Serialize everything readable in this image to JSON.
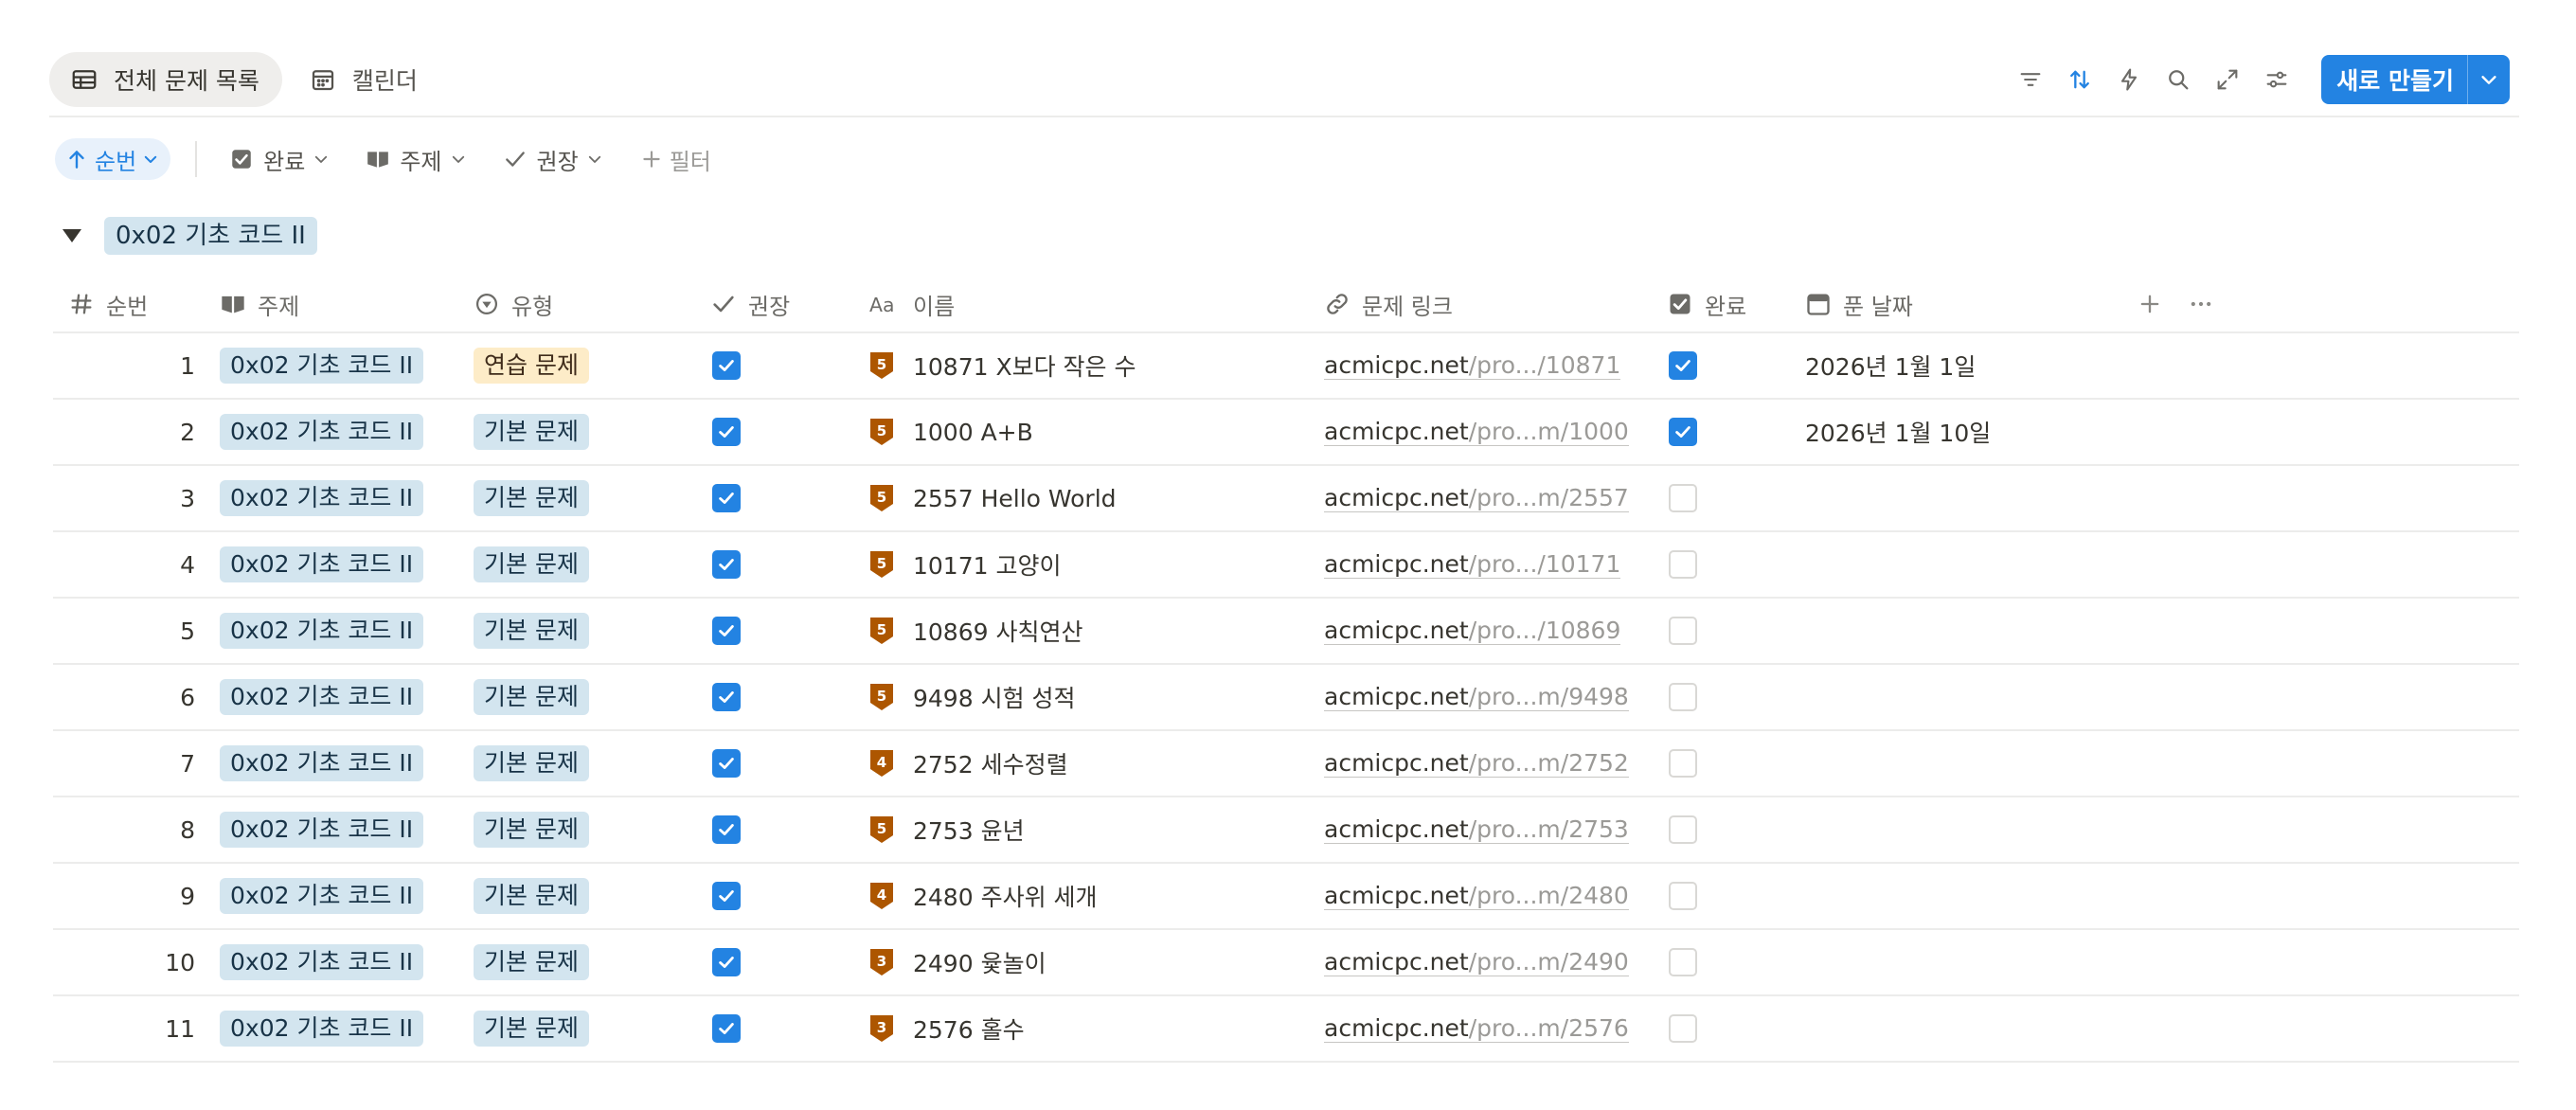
{
  "views": [
    {
      "label": "전체 문제 목록",
      "icon": "table-icon",
      "active": true
    },
    {
      "label": "캘린더",
      "icon": "calendar-icon",
      "active": false
    }
  ],
  "toolbar": {
    "icons": [
      "filter-icon",
      "sort-icon",
      "automation-icon",
      "search-icon",
      "expand-icon",
      "settings-icon"
    ],
    "new_label": "새로 만들기",
    "accent": "#2383e2"
  },
  "filters": {
    "sort_label": "순번",
    "chips": [
      {
        "label": "완료",
        "icon": "checkbox-icon"
      },
      {
        "label": "주제",
        "icon": "book-icon"
      },
      {
        "label": "권장",
        "icon": "check-icon"
      }
    ],
    "add_label": "필터"
  },
  "group": {
    "label": "0x02 기초 코드 II"
  },
  "columns": {
    "num": "순번",
    "topic": "주제",
    "type": "유형",
    "rec": "권장",
    "name": "이름",
    "link": "문제 링크",
    "done": "완료",
    "date": "푼 날짜"
  },
  "rows": [
    {
      "num": "1",
      "topic": "0x02 기초 코드 II",
      "type": "연습 문제",
      "rec": true,
      "tier": "5",
      "name": "10871 X보다 작은 수",
      "link_domain": "acmicpc.net",
      "link_path": "/pro.../10871",
      "done": true,
      "date": "2026년 1월 1일"
    },
    {
      "num": "2",
      "topic": "0x02 기초 코드 II",
      "type": "기본 문제",
      "rec": true,
      "tier": "5",
      "name": "1000 A+B",
      "link_domain": "acmicpc.net",
      "link_path": "/pro...m/1000",
      "done": true,
      "date": "2026년 1월 10일"
    },
    {
      "num": "3",
      "topic": "0x02 기초 코드 II",
      "type": "기본 문제",
      "rec": true,
      "tier": "5",
      "name": "2557 Hello World",
      "link_domain": "acmicpc.net",
      "link_path": "/pro...m/2557",
      "done": false,
      "date": ""
    },
    {
      "num": "4",
      "topic": "0x02 기초 코드 II",
      "type": "기본 문제",
      "rec": true,
      "tier": "5",
      "name": "10171 고양이",
      "link_domain": "acmicpc.net",
      "link_path": "/pro.../10171",
      "done": false,
      "date": ""
    },
    {
      "num": "5",
      "topic": "0x02 기초 코드 II",
      "type": "기본 문제",
      "rec": true,
      "tier": "5",
      "name": "10869 사칙연산",
      "link_domain": "acmicpc.net",
      "link_path": "/pro.../10869",
      "done": false,
      "date": ""
    },
    {
      "num": "6",
      "topic": "0x02 기초 코드 II",
      "type": "기본 문제",
      "rec": true,
      "tier": "5",
      "name": "9498 시험 성적",
      "link_domain": "acmicpc.net",
      "link_path": "/pro...m/9498",
      "done": false,
      "date": ""
    },
    {
      "num": "7",
      "topic": "0x02 기초 코드 II",
      "type": "기본 문제",
      "rec": true,
      "tier": "4",
      "name": "2752 세수정렬",
      "link_domain": "acmicpc.net",
      "link_path": "/pro...m/2752",
      "done": false,
      "date": ""
    },
    {
      "num": "8",
      "topic": "0x02 기초 코드 II",
      "type": "기본 문제",
      "rec": true,
      "tier": "5",
      "name": "2753 윤년",
      "link_domain": "acmicpc.net",
      "link_path": "/pro...m/2753",
      "done": false,
      "date": ""
    },
    {
      "num": "9",
      "topic": "0x02 기초 코드 II",
      "type": "기본 문제",
      "rec": true,
      "tier": "4",
      "name": "2480 주사위 세개",
      "link_domain": "acmicpc.net",
      "link_path": "/pro...m/2480",
      "done": false,
      "date": ""
    },
    {
      "num": "10",
      "topic": "0x02 기초 코드 II",
      "type": "기본 문제",
      "rec": true,
      "tier": "3",
      "name": "2490 윷놀이",
      "link_domain": "acmicpc.net",
      "link_path": "/pro...m/2490",
      "done": false,
      "date": ""
    },
    {
      "num": "11",
      "topic": "0x02 기초 코드 II",
      "type": "기본 문제",
      "rec": true,
      "tier": "3",
      "name": "2576 홀수",
      "link_domain": "acmicpc.net",
      "link_path": "/pro...m/2576",
      "done": false,
      "date": ""
    }
  ],
  "tier_color": "#ad5600"
}
